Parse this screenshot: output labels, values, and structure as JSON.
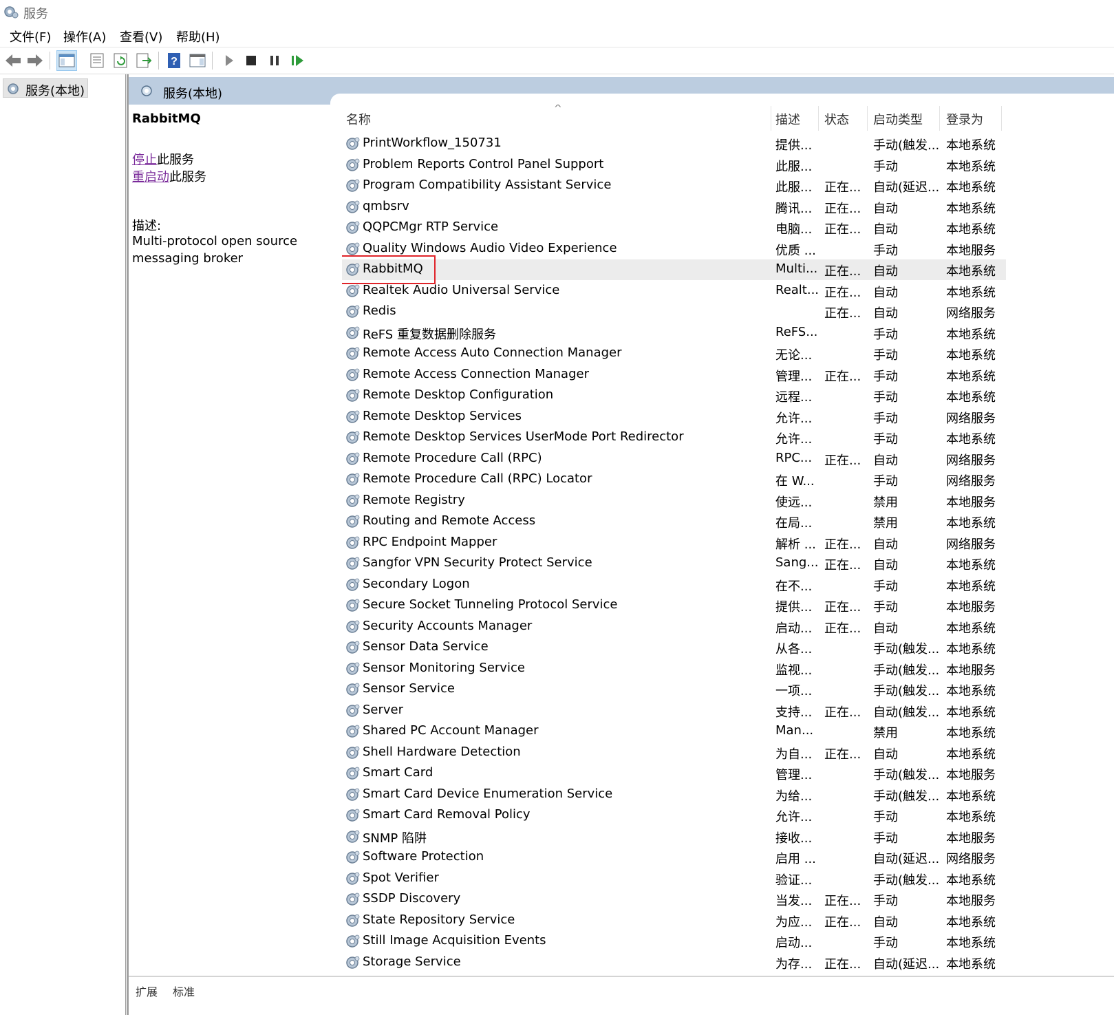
{
  "window": {
    "title": "服务"
  },
  "menu": [
    "文件(F)",
    "操作(A)",
    "查看(V)",
    "帮助(H)"
  ],
  "toolbar_icons": [
    "back-icon",
    "forward-icon",
    "show-console-tree-icon",
    "properties-icon",
    "refresh-icon",
    "export-list-icon",
    "help-icon",
    "action-pane-icon",
    "start-icon",
    "stop-icon",
    "pause-icon",
    "restart-icon"
  ],
  "tree": {
    "root_label": "服务(本地)"
  },
  "banner": {
    "label": "服务(本地)"
  },
  "detail": {
    "service_name": "RabbitMQ",
    "stop_link": "停止",
    "stop_suffix": "此服务",
    "restart_link": "重启动",
    "restart_suffix": "此服务",
    "desc_label": "描述:",
    "desc_text": "Multi-protocol open source messaging broker"
  },
  "columns": {
    "name": "名称",
    "desc": "描述",
    "status": "状态",
    "startup": "启动类型",
    "logon": "登录为"
  },
  "selected_service": "RabbitMQ",
  "services": [
    {
      "name": "PrintWorkflow_150731",
      "desc": "提供...",
      "status": "",
      "startup": "手动(触发...",
      "logon": "本地系统"
    },
    {
      "name": "Problem Reports Control Panel Support",
      "desc": "此服...",
      "status": "",
      "startup": "手动",
      "logon": "本地系统"
    },
    {
      "name": "Program Compatibility Assistant Service",
      "desc": "此服...",
      "status": "正在...",
      "startup": "自动(延迟...",
      "logon": "本地系统"
    },
    {
      "name": "qmbsrv",
      "desc": "腾讯...",
      "status": "正在...",
      "startup": "自动",
      "logon": "本地系统"
    },
    {
      "name": "QQPCMgr RTP Service",
      "desc": "电脑...",
      "status": "正在...",
      "startup": "自动",
      "logon": "本地系统"
    },
    {
      "name": "Quality Windows Audio Video Experience",
      "desc": "优质 ...",
      "status": "",
      "startup": "手动",
      "logon": "本地服务"
    },
    {
      "name": "RabbitMQ",
      "desc": "Multi...",
      "status": "正在...",
      "startup": "自动",
      "logon": "本地系统"
    },
    {
      "name": "Realtek Audio Universal Service",
      "desc": "Realt...",
      "status": "正在...",
      "startup": "自动",
      "logon": "本地系统"
    },
    {
      "name": "Redis",
      "desc": "",
      "status": "正在...",
      "startup": "自动",
      "logon": "网络服务"
    },
    {
      "name": "ReFS 重复数据删除服务",
      "desc": "ReFS...",
      "status": "",
      "startup": "手动",
      "logon": "本地系统"
    },
    {
      "name": "Remote Access Auto Connection Manager",
      "desc": "无论...",
      "status": "",
      "startup": "手动",
      "logon": "本地系统"
    },
    {
      "name": "Remote Access Connection Manager",
      "desc": "管理...",
      "status": "正在...",
      "startup": "手动",
      "logon": "本地系统"
    },
    {
      "name": "Remote Desktop Configuration",
      "desc": "远程...",
      "status": "",
      "startup": "手动",
      "logon": "本地系统"
    },
    {
      "name": "Remote Desktop Services",
      "desc": "允许...",
      "status": "",
      "startup": "手动",
      "logon": "网络服务"
    },
    {
      "name": "Remote Desktop Services UserMode Port Redirector",
      "desc": "允许...",
      "status": "",
      "startup": "手动",
      "logon": "本地系统"
    },
    {
      "name": "Remote Procedure Call (RPC)",
      "desc": "RPC...",
      "status": "正在...",
      "startup": "自动",
      "logon": "网络服务"
    },
    {
      "name": "Remote Procedure Call (RPC) Locator",
      "desc": "在 W...",
      "status": "",
      "startup": "手动",
      "logon": "网络服务"
    },
    {
      "name": "Remote Registry",
      "desc": "使远...",
      "status": "",
      "startup": "禁用",
      "logon": "本地服务"
    },
    {
      "name": "Routing and Remote Access",
      "desc": "在局...",
      "status": "",
      "startup": "禁用",
      "logon": "本地系统"
    },
    {
      "name": "RPC Endpoint Mapper",
      "desc": "解析 ...",
      "status": "正在...",
      "startup": "自动",
      "logon": "网络服务"
    },
    {
      "name": "Sangfor VPN Security Protect Service",
      "desc": "Sang...",
      "status": "正在...",
      "startup": "自动",
      "logon": "本地系统"
    },
    {
      "name": "Secondary Logon",
      "desc": "在不...",
      "status": "",
      "startup": "手动",
      "logon": "本地系统"
    },
    {
      "name": "Secure Socket Tunneling Protocol Service",
      "desc": "提供...",
      "status": "正在...",
      "startup": "手动",
      "logon": "本地服务"
    },
    {
      "name": "Security Accounts Manager",
      "desc": "启动...",
      "status": "正在...",
      "startup": "自动",
      "logon": "本地系统"
    },
    {
      "name": "Sensor Data Service",
      "desc": "从各...",
      "status": "",
      "startup": "手动(触发...",
      "logon": "本地系统"
    },
    {
      "name": "Sensor Monitoring Service",
      "desc": "监视...",
      "status": "",
      "startup": "手动(触发...",
      "logon": "本地服务"
    },
    {
      "name": "Sensor Service",
      "desc": "一项...",
      "status": "",
      "startup": "手动(触发...",
      "logon": "本地系统"
    },
    {
      "name": "Server",
      "desc": "支持...",
      "status": "正在...",
      "startup": "自动(触发...",
      "logon": "本地系统"
    },
    {
      "name": "Shared PC Account Manager",
      "desc": "Man...",
      "status": "",
      "startup": "禁用",
      "logon": "本地系统"
    },
    {
      "name": "Shell Hardware Detection",
      "desc": "为自...",
      "status": "正在...",
      "startup": "自动",
      "logon": "本地系统"
    },
    {
      "name": "Smart Card",
      "desc": "管理...",
      "status": "",
      "startup": "手动(触发...",
      "logon": "本地服务"
    },
    {
      "name": "Smart Card Device Enumeration Service",
      "desc": "为给...",
      "status": "",
      "startup": "手动(触发...",
      "logon": "本地系统"
    },
    {
      "name": "Smart Card Removal Policy",
      "desc": "允许...",
      "status": "",
      "startup": "手动",
      "logon": "本地系统"
    },
    {
      "name": "SNMP 陷阱",
      "desc": "接收...",
      "status": "",
      "startup": "手动",
      "logon": "本地服务"
    },
    {
      "name": "Software Protection",
      "desc": "启用 ...",
      "status": "",
      "startup": "自动(延迟...",
      "logon": "网络服务"
    },
    {
      "name": "Spot Verifier",
      "desc": "验证...",
      "status": "",
      "startup": "手动(触发...",
      "logon": "本地系统"
    },
    {
      "name": "SSDP Discovery",
      "desc": "当发...",
      "status": "正在...",
      "startup": "手动",
      "logon": "本地服务"
    },
    {
      "name": "State Repository Service",
      "desc": "为应...",
      "status": "正在...",
      "startup": "自动",
      "logon": "本地系统"
    },
    {
      "name": "Still Image Acquisition Events",
      "desc": "启动...",
      "status": "",
      "startup": "手动",
      "logon": "本地系统"
    },
    {
      "name": "Storage Service",
      "desc": "为存...",
      "status": "正在...",
      "startup": "自动(延迟...",
      "logon": "本地系统"
    }
  ],
  "bottom_tabs": [
    "扩展",
    "标准"
  ],
  "colors": {
    "banner": "#bccde0",
    "selection_outline": "#e0242a",
    "link": "#7a2a9a",
    "selected_row": "#ececec"
  }
}
